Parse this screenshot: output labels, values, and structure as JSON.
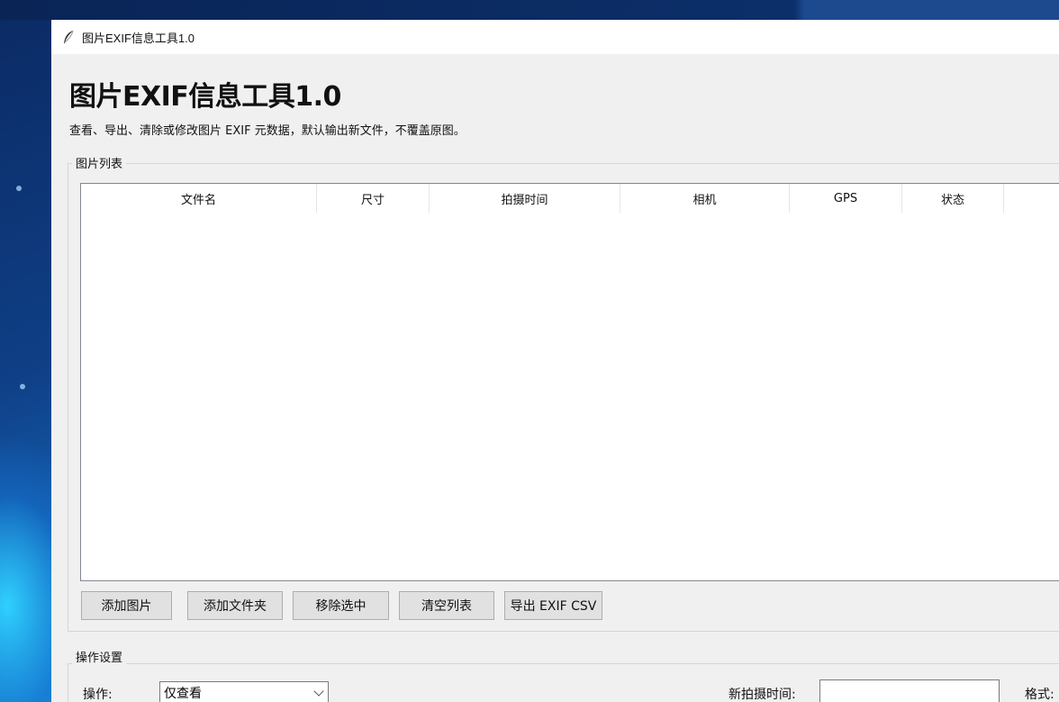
{
  "window": {
    "title": "图片EXIF信息工具1.0"
  },
  "header": {
    "title": "图片EXIF信息工具1.0",
    "subtitle": "查看、导出、清除或修改图片 EXIF 元数据，默认输出新文件，不覆盖原图。"
  },
  "image_list": {
    "group_label": "图片列表",
    "columns": [
      "文件名",
      "尺寸",
      "拍摄时间",
      "相机",
      "GPS",
      "状态"
    ],
    "rows": []
  },
  "buttons": {
    "add_images": "添加图片",
    "add_folder": "添加文件夹",
    "remove_selected": "移除选中",
    "clear_list": "清空列表",
    "export_csv": "导出 EXIF CSV"
  },
  "settings": {
    "group_label": "操作设置",
    "operation_label": "操作:",
    "operation_value": "仅查看",
    "new_time_label": "新拍摄时间:",
    "new_time_value": "",
    "format_label": "格式:"
  }
}
